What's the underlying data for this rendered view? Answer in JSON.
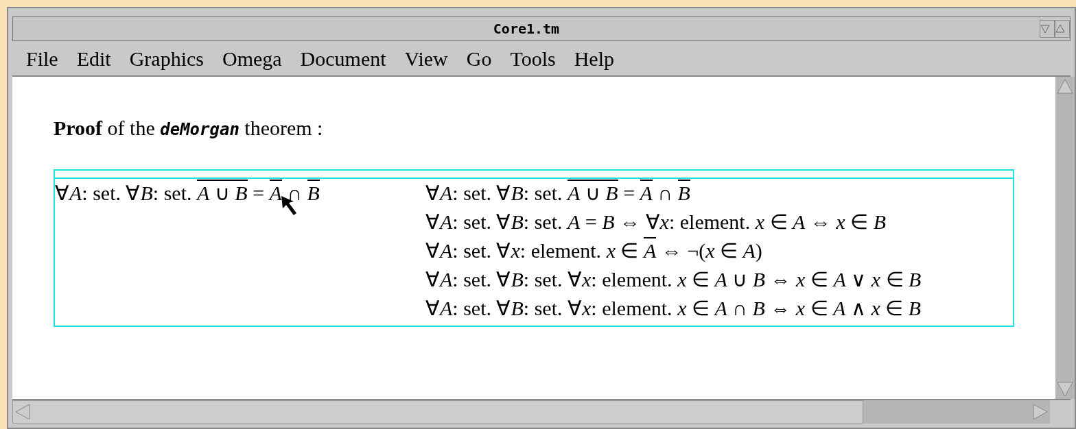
{
  "window": {
    "title": "Core1.tm"
  },
  "menu": [
    "File",
    "Edit",
    "Graphics",
    "Omega",
    "Document",
    "View",
    "Go",
    "Tools",
    "Help"
  ],
  "heading": [
    {
      "t": "Proof",
      "kind": "bold"
    },
    {
      "t": " of the ",
      "kind": "plain"
    },
    {
      "t": "deMorgan",
      "kind": "mono"
    },
    {
      "t": " theorem :",
      "kind": "plain"
    }
  ],
  "table": {
    "left": [
      {
        "t": "∀*A*: set. ∀*B*: set. "
      },
      {
        "t": "*A* ∪ *B*",
        "overline": true
      },
      {
        "t": " = "
      },
      {
        "t": "*A*",
        "overline": true
      },
      {
        "t": " ∩ "
      },
      {
        "t": "*B*",
        "overline": true
      }
    ],
    "right": [
      [
        {
          "t": "∀*A*: set. ∀*B*: set. "
        },
        {
          "t": "*A* ∪ *B*",
          "overline": true
        },
        {
          "t": " = "
        },
        {
          "t": "*A*",
          "overline": true
        },
        {
          "t": " ∩ "
        },
        {
          "t": "*B*",
          "overline": true
        }
      ],
      [
        {
          "t": "∀*A*: set. ∀*B*: set. *A* = *B* ⇔ ∀*x*: element. *x* ∈ *A* ⇔ *x* ∈ *B*"
        }
      ],
      [
        {
          "t": "∀*A*: set. ∀*x*: element. *x* ∈ "
        },
        {
          "t": "*A*",
          "overline": true
        },
        {
          "t": " ⇔ ¬(*x* ∈ *A*)"
        }
      ],
      [
        {
          "t": "∀*A*: set. ∀*B*: set. ∀*x*: element. *x* ∈ *A* ∪ *B* ⇔ *x* ∈ *A* ∨ *x* ∈ *B*"
        }
      ],
      [
        {
          "t": "∀*A*: set. ∀*B*: set. ∀*x*: element. *x* ∈ *A* ∩ *B* ⇔ *x* ∈ *A* ∧ *x* ∈ *B*"
        }
      ]
    ]
  }
}
